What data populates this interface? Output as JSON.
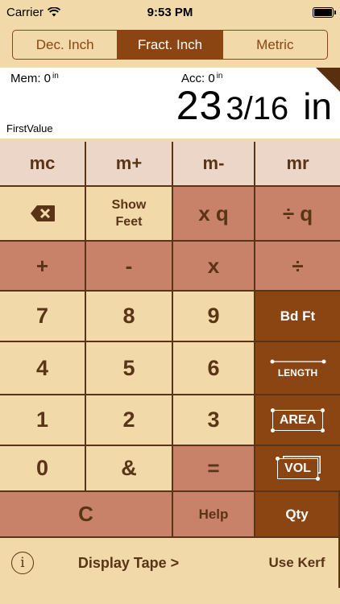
{
  "status_bar": {
    "carrier": "Carrier",
    "time": "9:53 PM"
  },
  "units": {
    "tabs": [
      "Dec. Inch",
      "Fract. Inch",
      "Metric"
    ],
    "selected": "Fract. Inch"
  },
  "display": {
    "mem_label": "Mem:",
    "mem_value": "0",
    "mem_unit": "in",
    "acc_label": "Acc:",
    "acc_value": "0",
    "acc_unit": "in",
    "main_whole": "23",
    "main_fraction": "3/16",
    "main_unit": "in",
    "input_label": "FirstValue"
  },
  "keys": {
    "mc": "mc",
    "m_plus": "m+",
    "m_minus": "m-",
    "mr": "mr",
    "backspace": "⌫",
    "show_feet_1": "Show",
    "show_feet_2": "Feet",
    "times_q": "x q",
    "divide_q": "÷ q",
    "plus": "+",
    "minus": "-",
    "times": "x",
    "divide": "÷",
    "n7": "7",
    "n8": "8",
    "n9": "9",
    "bd_ft": "Bd Ft",
    "n4": "4",
    "n5": "5",
    "n6": "6",
    "length": "LENGTH",
    "n1": "1",
    "n2": "2",
    "n3": "3",
    "area": "AREA",
    "n0": "0",
    "amp": "&",
    "equals": "=",
    "vol": "VOL",
    "clear": "C",
    "help": "Help",
    "qty": "Qty",
    "info": "i",
    "display_tape": "Display Tape >",
    "use_kerf": "Use Kerf"
  },
  "colors": {
    "brown": "#8b4513",
    "tan": "#f1d9a9",
    "rose": "#c9826a",
    "memrow": "#ebd6c8",
    "text": "#5a3416"
  }
}
